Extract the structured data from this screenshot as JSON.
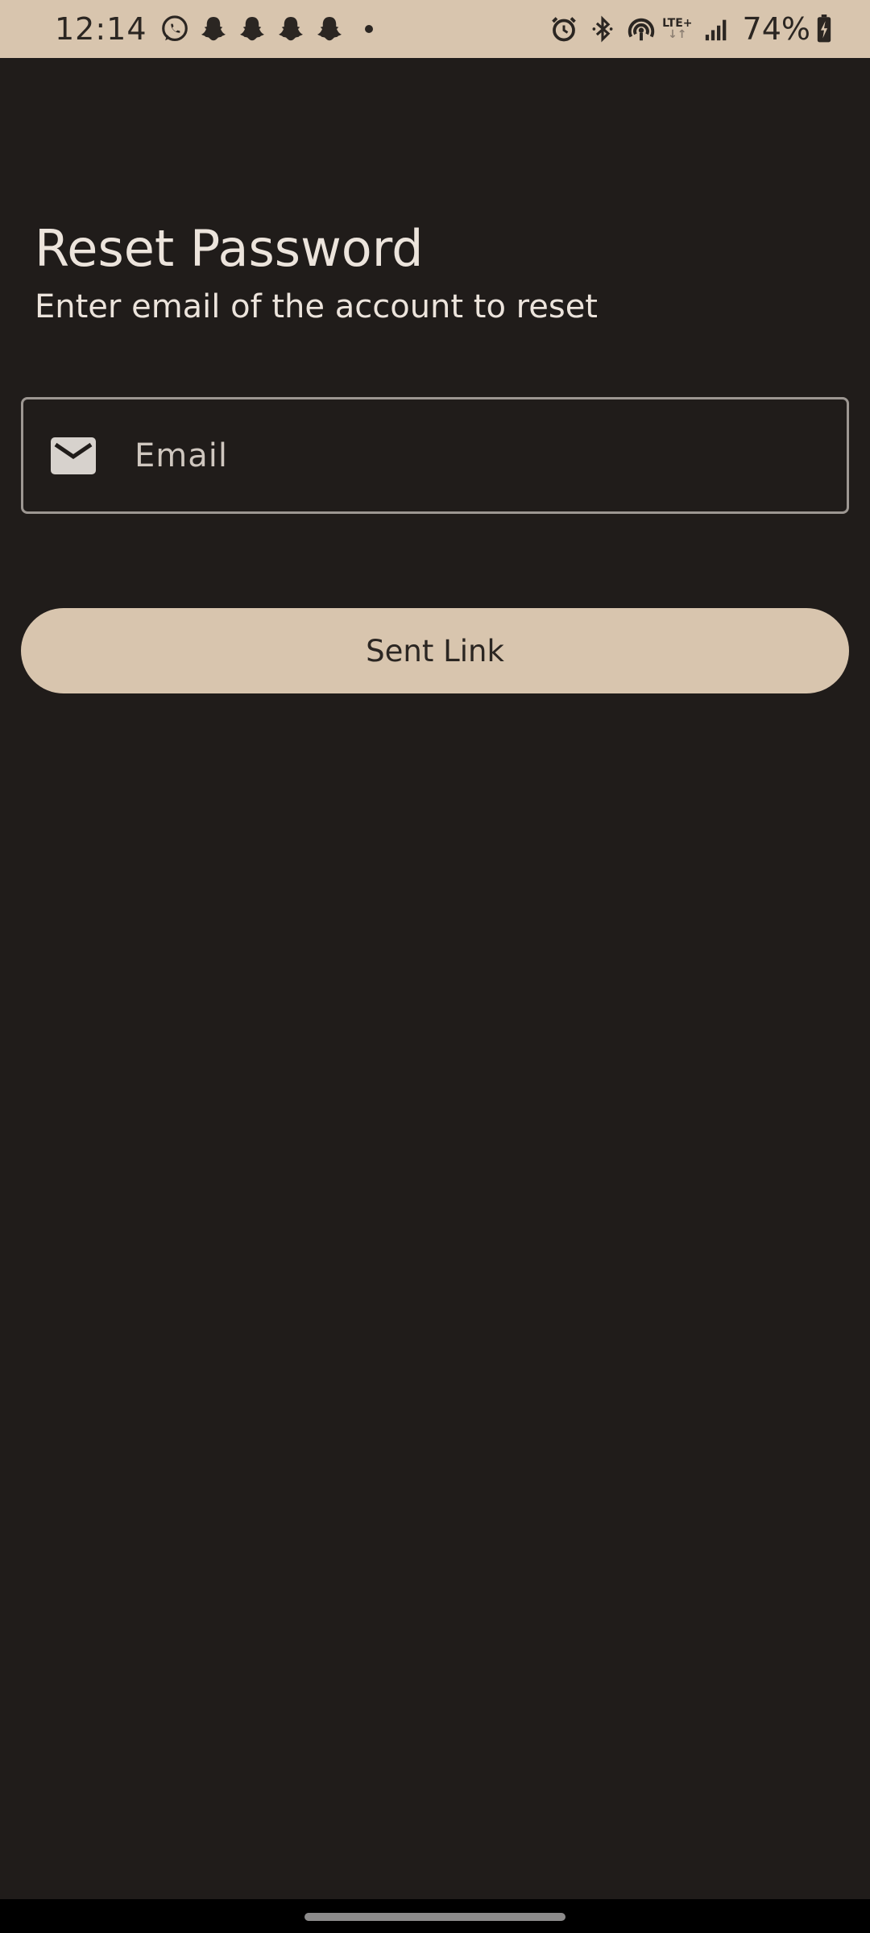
{
  "status_bar": {
    "time": "12:14",
    "battery": "74%",
    "network": "LTE+",
    "notification_icons": [
      "whatsapp-icon",
      "snapchat-icon",
      "snapchat-icon",
      "snapchat-icon",
      "snapchat-icon",
      "more-dot-icon"
    ],
    "system_icons": [
      "alarm-icon",
      "bluetooth-icon",
      "hotspot-icon",
      "lte-icon",
      "signal-icon",
      "battery-charging-icon"
    ]
  },
  "page": {
    "title": "Reset Password",
    "subtitle": "Enter email of the account to reset"
  },
  "email_field": {
    "placeholder": "Email",
    "value": "",
    "icon": "mail-icon"
  },
  "send_button": {
    "label": "Sent Link"
  },
  "colors": {
    "background": "#201c1a",
    "accent": "#d8c5ae",
    "text": "#ece4dc",
    "field_border": "#9d9792"
  }
}
